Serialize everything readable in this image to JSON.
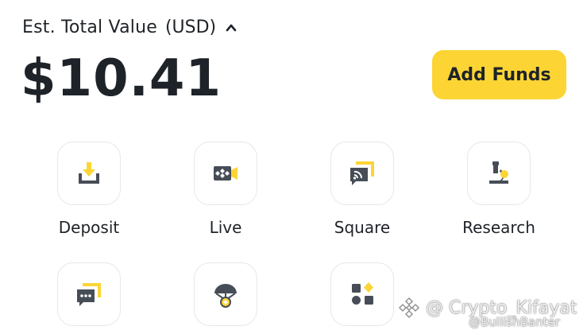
{
  "header": {
    "est_label": "Est. Total Value",
    "currency": "(USD)",
    "balance": "$10.41",
    "add_funds_label": "Add Funds"
  },
  "tiles": [
    {
      "label": "Deposit",
      "icon": "deposit-icon"
    },
    {
      "label": "Live",
      "icon": "live-icon"
    },
    {
      "label": "Square",
      "icon": "square-icon"
    },
    {
      "label": "Research",
      "icon": "research-icon"
    },
    {
      "label": "",
      "icon": "chat-icon"
    },
    {
      "label": "",
      "icon": "airdrop-icon"
    },
    {
      "label": "",
      "icon": "more-apps-icon"
    }
  ],
  "watermark": {
    "main": "@ Crypto_Kifayat",
    "sub": "@BullishBanter"
  },
  "colors": {
    "accent": "#fcd535",
    "text": "#1e2329",
    "icon_dark": "#474d57",
    "border": "#e6e8ea"
  }
}
